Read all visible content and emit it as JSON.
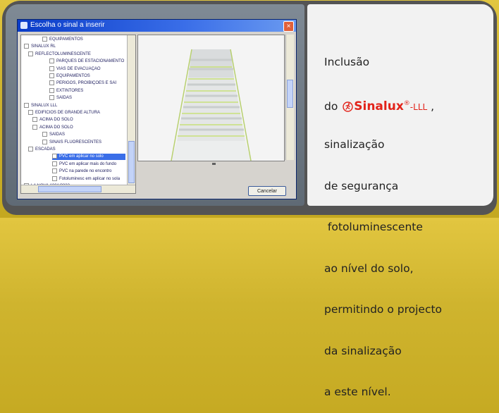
{
  "window": {
    "title": "Escolha o sinal a inserir",
    "close_glyph": "×",
    "cancel_label": "Cancelar"
  },
  "tree": {
    "rows": [
      {
        "label": "EQUIPAMENTOS",
        "selected": false
      },
      {
        "label": "SINALUX RL",
        "selected": false
      },
      {
        "label": "REFLECTOLUMINESCENTE",
        "selected": false
      },
      {
        "label": "PARQUES DE ESTACIONAMENTO",
        "selected": false
      },
      {
        "label": "VIAS DE EVACUAÇÃO",
        "selected": false
      },
      {
        "label": "EQUIPAMENTOS",
        "selected": false
      },
      {
        "label": "PERIGOS, PROIBIÇÕES E SAÍ",
        "selected": false
      },
      {
        "label": "EXTINTORES",
        "selected": false
      },
      {
        "label": "SAÍDAS",
        "selected": false
      },
      {
        "label": "SINALUX LLL",
        "selected": false
      },
      {
        "label": "EDIFÍCIOS DE GRANDE ALTURA",
        "selected": false
      },
      {
        "label": "ACIMA DO SOLO",
        "selected": false
      },
      {
        "label": "ACIMA DO SOLO",
        "selected": false
      },
      {
        "label": "SAÍDAS",
        "selected": false
      },
      {
        "label": "SINAIS FLUORESCENTES",
        "selected": false
      },
      {
        "label": "ESCADAS",
        "selected": false
      },
      {
        "label": "PVC em aplicar no solo",
        "selected": true
      },
      {
        "label": "PVC em aplicar mais do fundo",
        "selected": false
      },
      {
        "label": "PVC na parede no encontro",
        "selected": false
      },
      {
        "label": "Fotoluminesc em aplicar no sola",
        "selected": false
      },
      {
        "label": "LA NOVA 1001/3333",
        "selected": false
      }
    ]
  },
  "description": {
    "line1": "Inclusão",
    "line2_prefix": "do ",
    "brand_name": "Sinalux",
    "brand_sup": "®",
    "brand_suffix": "-LLL",
    "line2_end": " ,",
    "lines": [
      "sinalização",
      "de segurança",
      " fotoluminescente",
      "ao nível do solo,",
      "permitindo o projecto",
      "da sinalização",
      "a este nível."
    ]
  },
  "colors": {
    "brand_red": "#e2231a",
    "title_blue": "#0a3cc8",
    "background_yellow": "#d8bc34",
    "frame_gray": "#545454"
  },
  "icons": {
    "brand": "running-man-icon"
  }
}
